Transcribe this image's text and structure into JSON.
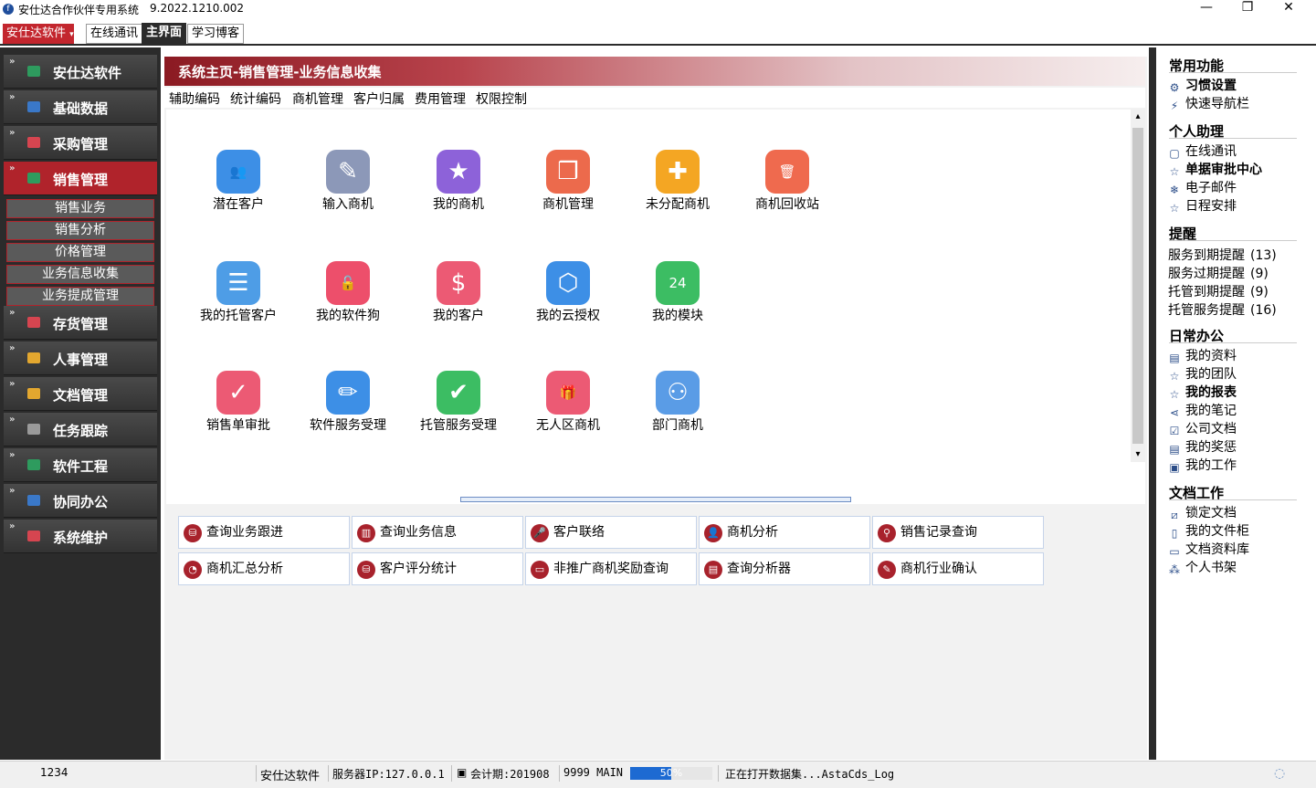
{
  "window": {
    "title": "安仕达合作伙伴专用系统",
    "version": "9.2022.1210.002",
    "minimize": "—",
    "restore": "❐",
    "close": "✕",
    "app_icon": "f"
  },
  "topbar": {
    "brand_button": "安仕达软件",
    "brand_caret": "▾",
    "tabs": [
      "在线通讯",
      "主界面",
      "学习博客"
    ],
    "active_tab": "主界面"
  },
  "sidebar": {
    "chevron": "»",
    "items": [
      {
        "label": "安仕达软件",
        "icon": "green-square-icon",
        "color": "#2e9b5e"
      },
      {
        "label": "基础数据",
        "icon": "blue-square-icon",
        "color": "#3a78c8"
      },
      {
        "label": "采购管理",
        "icon": "red-square-icon",
        "color": "#d64550"
      },
      {
        "label": "销售管理",
        "icon": "green-square-icon",
        "color": "#2e9b5e"
      },
      {
        "label": "存货管理",
        "icon": "red-square-icon",
        "color": "#d64550"
      },
      {
        "label": "人事管理",
        "icon": "yellow-square-icon",
        "color": "#e3a72f"
      },
      {
        "label": "文档管理",
        "icon": "yellow-square-icon",
        "color": "#e3a72f"
      },
      {
        "label": "任务跟踪",
        "icon": "gray-square-icon",
        "color": "#9a9a9a"
      },
      {
        "label": "软件工程",
        "icon": "green-square-icon",
        "color": "#2e9b5e"
      },
      {
        "label": "协同办公",
        "icon": "blue-square-icon",
        "color": "#3a78c8"
      },
      {
        "label": "系统维护",
        "icon": "red-square-icon",
        "color": "#d64550"
      }
    ],
    "active_item": "销售管理",
    "subitems": [
      "销售业务",
      "销售分析",
      "价格管理",
      "业务信息收集",
      "业务提成管理"
    ]
  },
  "main": {
    "breadcrumb": "系统主页-销售管理-业务信息收集",
    "submenu": [
      "辅助编码",
      "统计编码",
      "商机管理",
      "客户归属",
      "费用管理",
      "权限控制"
    ],
    "tiles": [
      {
        "label": "潜在客户",
        "icon": "users-icon",
        "glyph": "👥",
        "color": "#3d8fe6"
      },
      {
        "label": "输入商机",
        "icon": "edit-doc-icon",
        "glyph": "✎",
        "color": "#8c98b8"
      },
      {
        "label": "我的商机",
        "icon": "star-icon",
        "glyph": "★",
        "color": "#8d62d9"
      },
      {
        "label": "商机管理",
        "icon": "notebook-icon",
        "glyph": "❒",
        "color": "#ec6a4c"
      },
      {
        "label": "未分配商机",
        "icon": "puzzle-icon",
        "glyph": "✚",
        "color": "#f4a623"
      },
      {
        "label": "商机回收站",
        "icon": "trash-icon",
        "glyph": "🗑",
        "color": "#ef6a4e"
      },
      {
        "label": "我的托管客户",
        "icon": "user-card-icon",
        "glyph": "☰",
        "color": "#4e9de6"
      },
      {
        "label": "我的软件狗",
        "icon": "unlock-icon",
        "glyph": "🔓",
        "color": "#ed4f6b"
      },
      {
        "label": "我的客户",
        "icon": "user-money-icon",
        "glyph": "$",
        "color": "#ec5a74"
      },
      {
        "label": "我的云授权",
        "icon": "cubes-icon",
        "glyph": "⬡",
        "color": "#3d8fe6"
      },
      {
        "label": "我的模块",
        "icon": "calendar-icon",
        "glyph": "24",
        "color": "#3cbd63"
      },
      {
        "label": "销售单审批",
        "icon": "doc-check-icon",
        "glyph": "✓",
        "color": "#ec5a74"
      },
      {
        "label": "软件服务受理",
        "icon": "pencil-icon",
        "glyph": "✏",
        "color": "#3d8fe6"
      },
      {
        "label": "托管服务受理",
        "icon": "check-circle-icon",
        "glyph": "✔",
        "color": "#3cbd63"
      },
      {
        "label": "无人区商机",
        "icon": "gift-icon",
        "glyph": "🎁",
        "color": "#ec5a74"
      },
      {
        "label": "部门商机",
        "icon": "team-icon",
        "glyph": "⚇",
        "color": "#5a9ce6"
      }
    ],
    "quick_buttons": [
      {
        "label": "查询业务跟进",
        "glyph": "⛁"
      },
      {
        "label": "查询业务信息",
        "glyph": "▥"
      },
      {
        "label": "客户联络",
        "glyph": "🎤"
      },
      {
        "label": "商机分析",
        "glyph": "👤"
      },
      {
        "label": "销售记录查询",
        "glyph": "⚲"
      },
      {
        "label": "商机汇总分析",
        "glyph": "◔"
      },
      {
        "label": "客户评分统计",
        "glyph": "⛁"
      },
      {
        "label": "非推广商机奖励查询",
        "glyph": "▭"
      },
      {
        "label": "查询分析器",
        "glyph": "▤"
      },
      {
        "label": "商机行业确认",
        "glyph": "✎"
      }
    ],
    "scroll_up": "▴",
    "scroll_down": "▾"
  },
  "right": {
    "common_title": "常用功能",
    "common": [
      {
        "label": "习惯设置",
        "glyph": "⚙",
        "bold": true
      },
      {
        "label": "快速导航栏",
        "glyph": "⚡",
        "bold": false
      }
    ],
    "assistant_title": "个人助理",
    "assistant": [
      {
        "label": "在线通讯",
        "glyph": "▢",
        "bold": false
      },
      {
        "label": "单据审批中心",
        "glyph": "☆",
        "bold": true
      },
      {
        "label": "电子邮件",
        "glyph": "❄",
        "bold": false
      },
      {
        "label": "日程安排",
        "glyph": "☆",
        "bold": false
      }
    ],
    "reminder_title": "提醒",
    "reminders": [
      {
        "label": "服务到期提醒",
        "count": "(13)"
      },
      {
        "label": "服务过期提醒",
        "count": "(9)"
      },
      {
        "label": "托管到期提醒",
        "count": "(9)"
      },
      {
        "label": "托管服务提醒",
        "count": "(16)"
      }
    ],
    "office_title": "日常办公",
    "office": [
      {
        "label": "我的资料",
        "glyph": "▤",
        "bold": false
      },
      {
        "label": "我的团队",
        "glyph": "☆",
        "bold": false
      },
      {
        "label": "我的报表",
        "glyph": "☆",
        "bold": true
      },
      {
        "label": "我的笔记",
        "glyph": "⋖",
        "bold": false
      },
      {
        "label": "公司文档",
        "glyph": "☑",
        "bold": false
      },
      {
        "label": "我的奖惩",
        "glyph": "▤",
        "bold": false
      },
      {
        "label": "我的工作",
        "glyph": "▣",
        "bold": false
      }
    ],
    "docs_title": "文档工作",
    "docs": [
      {
        "label": "锁定文档",
        "glyph": "⧄",
        "bold": false
      },
      {
        "label": "我的文件柜",
        "glyph": "▯",
        "bold": false
      },
      {
        "label": "文档资料库",
        "glyph": "▭",
        "bold": false
      },
      {
        "label": "个人书架",
        "glyph": "⁂",
        "bold": false
      }
    ]
  },
  "status": {
    "code": "1234",
    "company": "安仕达软件",
    "server": "服务器IP:127.0.0.1",
    "period_icon": "▣",
    "period": "会计期:201908",
    "db": "9999 MAIN",
    "progress_pct": 50,
    "progress_label": "50%",
    "message": "正在打开数据集...AstaCds_Log",
    "tray": "◌"
  }
}
